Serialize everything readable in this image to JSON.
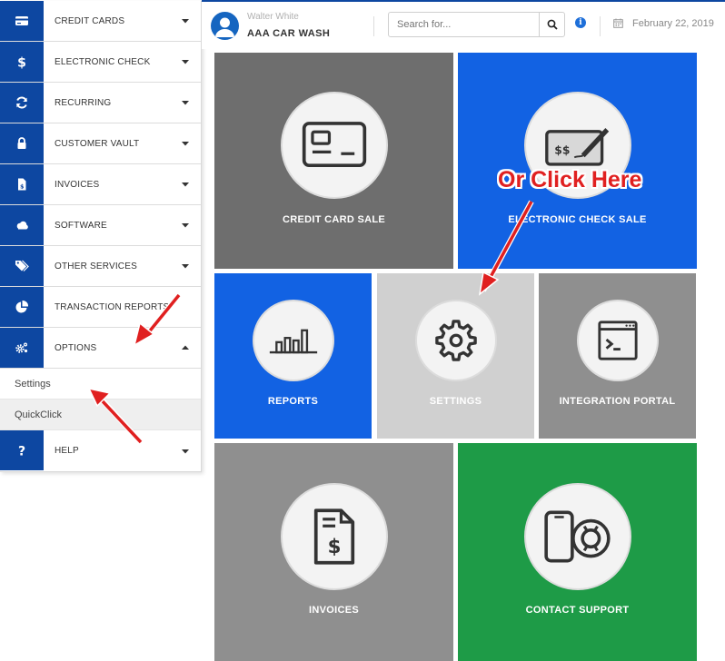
{
  "sidebar": {
    "items": [
      {
        "label": "CREDIT CARDS",
        "icon": "credit-card-icon"
      },
      {
        "label": "ELECTRONIC CHECK",
        "icon": "dollar-icon"
      },
      {
        "label": "RECURRING",
        "icon": "refresh-icon"
      },
      {
        "label": "CUSTOMER VAULT",
        "icon": "lock-icon"
      },
      {
        "label": "INVOICES",
        "icon": "invoice-icon"
      },
      {
        "label": "SOFTWARE",
        "icon": "cloud-icon"
      },
      {
        "label": "OTHER SERVICES",
        "icon": "tags-icon"
      },
      {
        "label": "TRANSACTION REPORTS",
        "icon": "pie-chart-icon"
      },
      {
        "label": "OPTIONS",
        "icon": "cogs-icon"
      }
    ],
    "options_submenu": [
      "Settings",
      "QuickClick"
    ],
    "help": {
      "label": "HELP",
      "icon": "question-icon"
    }
  },
  "header": {
    "user_name": "Walter White",
    "company": "AAA CAR WASH",
    "search_placeholder": "Search for...",
    "date": "February 22, 2019"
  },
  "tiles": [
    {
      "label": "CREDIT CARD SALE",
      "icon": "credit-card-icon",
      "color": "#6e6e6e"
    },
    {
      "label": "ELECTRONIC CHECK SALE",
      "icon": "check-sign-icon",
      "color": "#1262e3"
    },
    {
      "label": "REPORTS",
      "icon": "bar-chart-icon",
      "color": "#1262e3"
    },
    {
      "label": "SETTINGS",
      "icon": "gear-icon",
      "color": "#d0d0d0"
    },
    {
      "label": "INTEGRATION PORTAL",
      "icon": "terminal-icon",
      "color": "#8f8f8f"
    },
    {
      "label": "INVOICES",
      "icon": "invoice-icon",
      "color": "#8f8f8f"
    },
    {
      "label": "CONTACT SUPPORT",
      "icon": "phone-lifebuoy-icon",
      "color": "#1e9b47"
    }
  ],
  "annotation": {
    "callout": "Or Click Here",
    "color": "#e02020"
  },
  "colors": {
    "nav_blue": "#0d47a1",
    "accent_blue": "#1262e3",
    "green": "#1e9b47"
  }
}
